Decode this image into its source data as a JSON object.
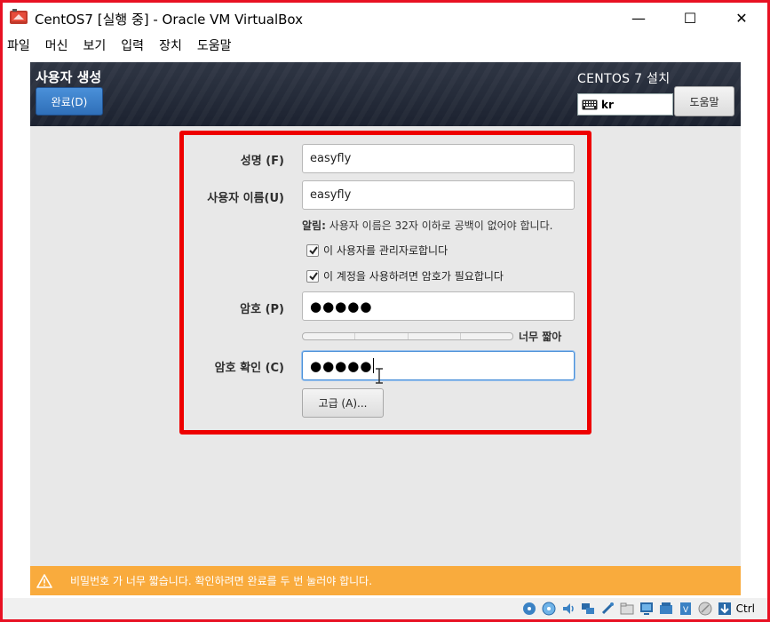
{
  "window": {
    "title": "CentOS7 [실행 중] - Oracle VM VirtualBox",
    "minimize": "—",
    "maximize": "☐",
    "close": "✕"
  },
  "menu": [
    "파일",
    "머신",
    "보기",
    "입력",
    "장치",
    "도움말"
  ],
  "installer": {
    "page_title": "사용자 생성",
    "done_label": "완료(D)",
    "install_title": "CENTOS 7 설치",
    "keyboard_layout": "kr",
    "help_label": "도움말"
  },
  "form": {
    "fullname_label": "성명 (F)",
    "fullname_value": "easyfly",
    "username_label": "사용자 이름(U)",
    "username_value": "easyfly",
    "hint_prefix": "알림:",
    "hint_text": "사용자 이름은 32자 이하로 공백이 없어야 합니다.",
    "admin_checkbox": "이 사용자를 관리자로합니다",
    "admin_checked": true,
    "require_password_checkbox": "이 계정을 사용하려면 암호가 필요합니다",
    "require_password_checked": true,
    "password_label": "암호 (P)",
    "password_value": "●●●●●",
    "strength_text": "너무 짧아",
    "strength_level": 0,
    "confirm_label": "암호 확인 (C)",
    "confirm_value": "●●●●●",
    "advanced_label": "고급 (A)..."
  },
  "warning": {
    "text": "비밀번호 가 너무 짧습니다.  확인하려면 완료를 두 번 눌러야 합니다."
  },
  "statusbar": {
    "host_key": "Ctrl"
  },
  "colors": {
    "highlight_frame": "#ee0000",
    "window_border": "#e81123",
    "header_bg": "#2f3644",
    "done_button": "#4a90d9",
    "warning_bar": "#f9ab3d"
  }
}
